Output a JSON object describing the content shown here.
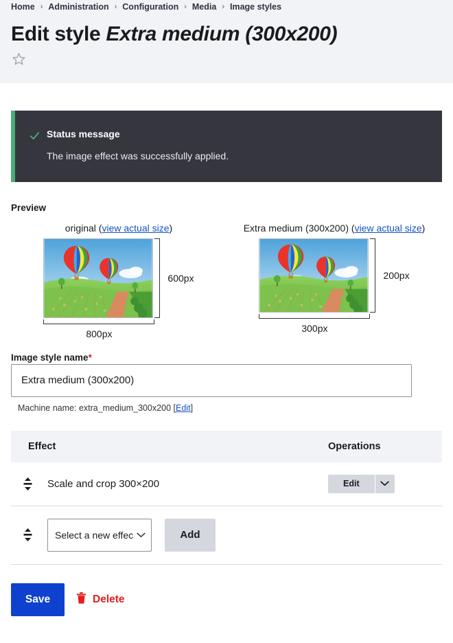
{
  "breadcrumb": {
    "separator": "›",
    "items": [
      {
        "label": "Home"
      },
      {
        "label": "Administration"
      },
      {
        "label": "Configuration"
      },
      {
        "label": "Media"
      },
      {
        "label": "Image styles"
      }
    ]
  },
  "header": {
    "title_prefix": "Edit style ",
    "style_name": "Extra medium (300x200)",
    "bookmark_icon": "star-outline-icon"
  },
  "status": {
    "icon": "check-icon",
    "title": "Status message",
    "text": "The image effect was successfully applied.",
    "accent_color": "#4aad79",
    "background_color": "#36363f"
  },
  "preview": {
    "label": "Preview",
    "original": {
      "caption_prefix": "original (",
      "link_text": "view actual size",
      "caption_suffix": ")",
      "width_label": "800px",
      "height_label": "600px"
    },
    "derived": {
      "caption_prefix": "Extra medium (300x200) (",
      "link_text": "view actual size",
      "caption_suffix": ")",
      "width_label": "300px",
      "height_label": "200px"
    }
  },
  "form": {
    "name_label": "Image style name",
    "required_marker": "*",
    "name_value": "Extra medium (300x200)",
    "name_placeholder": "Image style name",
    "machine_name_prefix": "Machine name: ",
    "machine_name_value": "extra_medium_300x200",
    "machine_name_bracket_open": " [",
    "machine_name_edit_link": "Edit",
    "machine_name_bracket_close": "]"
  },
  "effects_table": {
    "columns": [
      "Effect",
      "Operations"
    ],
    "rows": [
      {
        "drag_icon": "drag-vertical-icon",
        "effect": "Scale and crop 300×200",
        "operation_label": "Edit",
        "operation_caret": "chevron-down-icon"
      }
    ],
    "add_row": {
      "drag_icon": "drag-vertical-icon",
      "select_value": "Select a new effect",
      "select_options": [
        "Select a new effect"
      ],
      "add_label": "Add"
    }
  },
  "actions": {
    "save_label": "Save",
    "delete_label": "Delete",
    "delete_icon": "trash-icon",
    "save_color": "#0e41ce",
    "delete_color": "#e02020"
  }
}
